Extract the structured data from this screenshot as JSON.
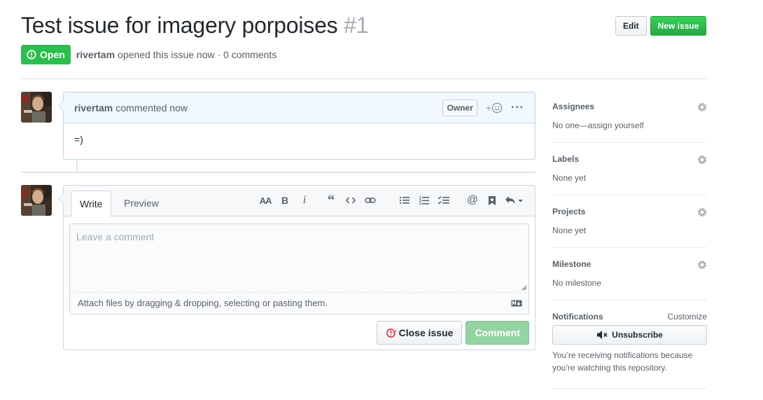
{
  "issue": {
    "title": "Test issue for imagery porpoises",
    "number": "#1",
    "state": "Open",
    "author": "rivertam",
    "opened_text": "opened this issue now · 0 comments"
  },
  "header_actions": {
    "edit": "Edit",
    "new_issue": "New issue"
  },
  "comment": {
    "author": "rivertam",
    "action": "commented now",
    "badge": "Owner",
    "reaction_plus": "+",
    "body": "=)"
  },
  "form": {
    "tab_write": "Write",
    "tab_preview": "Preview",
    "placeholder": "Leave a comment",
    "attach_text": "Attach files by dragging & dropping, selecting or pasting them.",
    "close_label": "Close issue",
    "comment_label": "Comment",
    "toolbar": [
      "header-icon",
      "bold-icon",
      "italic-icon",
      "quote-icon",
      "code-icon",
      "link-icon",
      "unordered-list-icon",
      "ordered-list-icon",
      "task-list-icon",
      "mention-icon",
      "saved-reply-icon",
      "reply-icon"
    ]
  },
  "sidebar": {
    "assignees": {
      "label": "Assignees",
      "value": "No one—assign yourself"
    },
    "labels": {
      "label": "Labels",
      "value": "None yet"
    },
    "projects": {
      "label": "Projects",
      "value": "None yet"
    },
    "milestone": {
      "label": "Milestone",
      "value": "No milestone"
    },
    "notifications": {
      "label": "Notifications",
      "customize": "Customize",
      "unsubscribe": "Unsubscribe",
      "text": "You’re receiving notifications because you’re watching this repository."
    }
  },
  "colors": {
    "green": "#2cbe4e",
    "comment_header_bg": "#f1f8ff",
    "border_blue": "#c0d3eb"
  }
}
